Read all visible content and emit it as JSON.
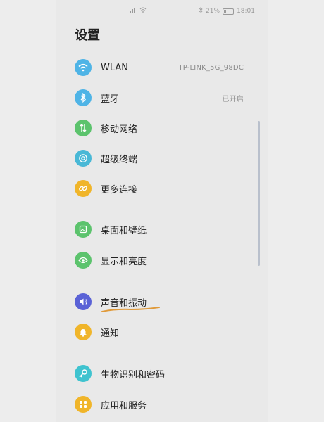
{
  "status": {
    "battery_text": "21%",
    "time": "18:01"
  },
  "page": {
    "title": "设置"
  },
  "items": [
    {
      "label": "WLAN",
      "value": "TP-LINK_5G_98DC",
      "icon": "wifi-icon",
      "color": "#4fb4e6"
    },
    {
      "label": "蓝牙",
      "value": "已开启",
      "icon": "bluetooth-icon",
      "color": "#4fb4e6"
    },
    {
      "label": "移动网络",
      "value": "",
      "icon": "mobile-network-icon",
      "color": "#5cc36d"
    },
    {
      "label": "超级终端",
      "value": "",
      "icon": "super-device-icon",
      "color": "#49b8d6"
    },
    {
      "label": "更多连接",
      "value": "",
      "icon": "link-icon",
      "color": "#f0b52a"
    },
    {
      "label": "桌面和壁纸",
      "value": "",
      "icon": "wallpaper-icon",
      "color": "#5cc36d"
    },
    {
      "label": "显示和亮度",
      "value": "",
      "icon": "eye-icon",
      "color": "#5cc36d"
    },
    {
      "label": "声音和振动",
      "value": "",
      "icon": "speaker-icon",
      "color": "#5a62d6"
    },
    {
      "label": "通知",
      "value": "",
      "icon": "bell-icon",
      "color": "#f0b52a"
    },
    {
      "label": "生物识别和密码",
      "value": "",
      "icon": "key-icon",
      "color": "#3fc3cf"
    },
    {
      "label": "应用和服务",
      "value": "",
      "icon": "apps-icon",
      "color": "#f0b52a"
    }
  ],
  "colors": {
    "annotation_underline": "#e09a3a",
    "scrollbar": "#b9c0cc"
  }
}
